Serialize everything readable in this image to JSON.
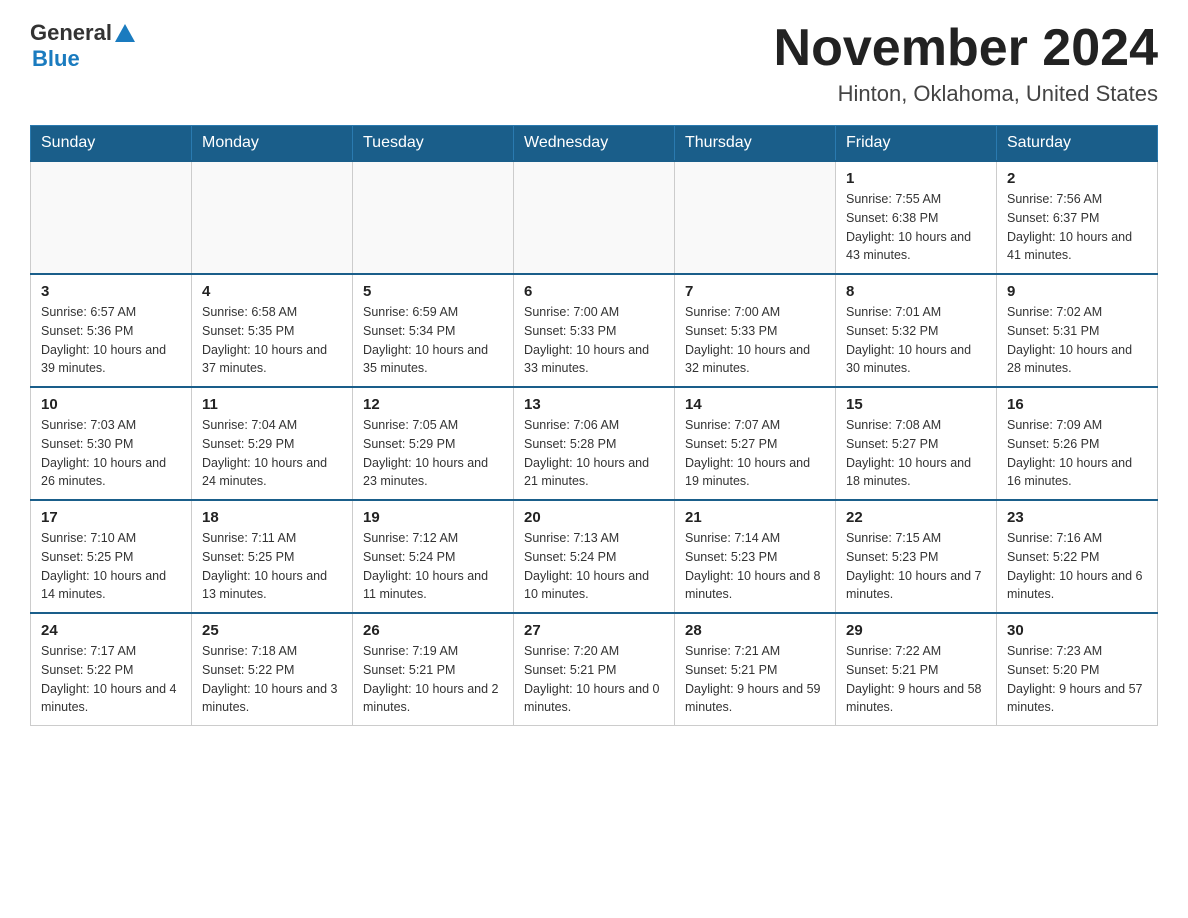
{
  "header": {
    "logo": {
      "general": "General",
      "blue": "Blue"
    },
    "title": "November 2024",
    "location": "Hinton, Oklahoma, United States"
  },
  "calendar": {
    "days_of_week": [
      "Sunday",
      "Monday",
      "Tuesday",
      "Wednesday",
      "Thursday",
      "Friday",
      "Saturday"
    ],
    "weeks": [
      {
        "days": [
          {
            "number": "",
            "info": ""
          },
          {
            "number": "",
            "info": ""
          },
          {
            "number": "",
            "info": ""
          },
          {
            "number": "",
            "info": ""
          },
          {
            "number": "",
            "info": ""
          },
          {
            "number": "1",
            "info": "Sunrise: 7:55 AM\nSunset: 6:38 PM\nDaylight: 10 hours and 43 minutes."
          },
          {
            "number": "2",
            "info": "Sunrise: 7:56 AM\nSunset: 6:37 PM\nDaylight: 10 hours and 41 minutes."
          }
        ]
      },
      {
        "days": [
          {
            "number": "3",
            "info": "Sunrise: 6:57 AM\nSunset: 5:36 PM\nDaylight: 10 hours and 39 minutes."
          },
          {
            "number": "4",
            "info": "Sunrise: 6:58 AM\nSunset: 5:35 PM\nDaylight: 10 hours and 37 minutes."
          },
          {
            "number": "5",
            "info": "Sunrise: 6:59 AM\nSunset: 5:34 PM\nDaylight: 10 hours and 35 minutes."
          },
          {
            "number": "6",
            "info": "Sunrise: 7:00 AM\nSunset: 5:33 PM\nDaylight: 10 hours and 33 minutes."
          },
          {
            "number": "7",
            "info": "Sunrise: 7:00 AM\nSunset: 5:33 PM\nDaylight: 10 hours and 32 minutes."
          },
          {
            "number": "8",
            "info": "Sunrise: 7:01 AM\nSunset: 5:32 PM\nDaylight: 10 hours and 30 minutes."
          },
          {
            "number": "9",
            "info": "Sunrise: 7:02 AM\nSunset: 5:31 PM\nDaylight: 10 hours and 28 minutes."
          }
        ]
      },
      {
        "days": [
          {
            "number": "10",
            "info": "Sunrise: 7:03 AM\nSunset: 5:30 PM\nDaylight: 10 hours and 26 minutes."
          },
          {
            "number": "11",
            "info": "Sunrise: 7:04 AM\nSunset: 5:29 PM\nDaylight: 10 hours and 24 minutes."
          },
          {
            "number": "12",
            "info": "Sunrise: 7:05 AM\nSunset: 5:29 PM\nDaylight: 10 hours and 23 minutes."
          },
          {
            "number": "13",
            "info": "Sunrise: 7:06 AM\nSunset: 5:28 PM\nDaylight: 10 hours and 21 minutes."
          },
          {
            "number": "14",
            "info": "Sunrise: 7:07 AM\nSunset: 5:27 PM\nDaylight: 10 hours and 19 minutes."
          },
          {
            "number": "15",
            "info": "Sunrise: 7:08 AM\nSunset: 5:27 PM\nDaylight: 10 hours and 18 minutes."
          },
          {
            "number": "16",
            "info": "Sunrise: 7:09 AM\nSunset: 5:26 PM\nDaylight: 10 hours and 16 minutes."
          }
        ]
      },
      {
        "days": [
          {
            "number": "17",
            "info": "Sunrise: 7:10 AM\nSunset: 5:25 PM\nDaylight: 10 hours and 14 minutes."
          },
          {
            "number": "18",
            "info": "Sunrise: 7:11 AM\nSunset: 5:25 PM\nDaylight: 10 hours and 13 minutes."
          },
          {
            "number": "19",
            "info": "Sunrise: 7:12 AM\nSunset: 5:24 PM\nDaylight: 10 hours and 11 minutes."
          },
          {
            "number": "20",
            "info": "Sunrise: 7:13 AM\nSunset: 5:24 PM\nDaylight: 10 hours and 10 minutes."
          },
          {
            "number": "21",
            "info": "Sunrise: 7:14 AM\nSunset: 5:23 PM\nDaylight: 10 hours and 8 minutes."
          },
          {
            "number": "22",
            "info": "Sunrise: 7:15 AM\nSunset: 5:23 PM\nDaylight: 10 hours and 7 minutes."
          },
          {
            "number": "23",
            "info": "Sunrise: 7:16 AM\nSunset: 5:22 PM\nDaylight: 10 hours and 6 minutes."
          }
        ]
      },
      {
        "days": [
          {
            "number": "24",
            "info": "Sunrise: 7:17 AM\nSunset: 5:22 PM\nDaylight: 10 hours and 4 minutes."
          },
          {
            "number": "25",
            "info": "Sunrise: 7:18 AM\nSunset: 5:22 PM\nDaylight: 10 hours and 3 minutes."
          },
          {
            "number": "26",
            "info": "Sunrise: 7:19 AM\nSunset: 5:21 PM\nDaylight: 10 hours and 2 minutes."
          },
          {
            "number": "27",
            "info": "Sunrise: 7:20 AM\nSunset: 5:21 PM\nDaylight: 10 hours and 0 minutes."
          },
          {
            "number": "28",
            "info": "Sunrise: 7:21 AM\nSunset: 5:21 PM\nDaylight: 9 hours and 59 minutes."
          },
          {
            "number": "29",
            "info": "Sunrise: 7:22 AM\nSunset: 5:21 PM\nDaylight: 9 hours and 58 minutes."
          },
          {
            "number": "30",
            "info": "Sunrise: 7:23 AM\nSunset: 5:20 PM\nDaylight: 9 hours and 57 minutes."
          }
        ]
      }
    ]
  }
}
